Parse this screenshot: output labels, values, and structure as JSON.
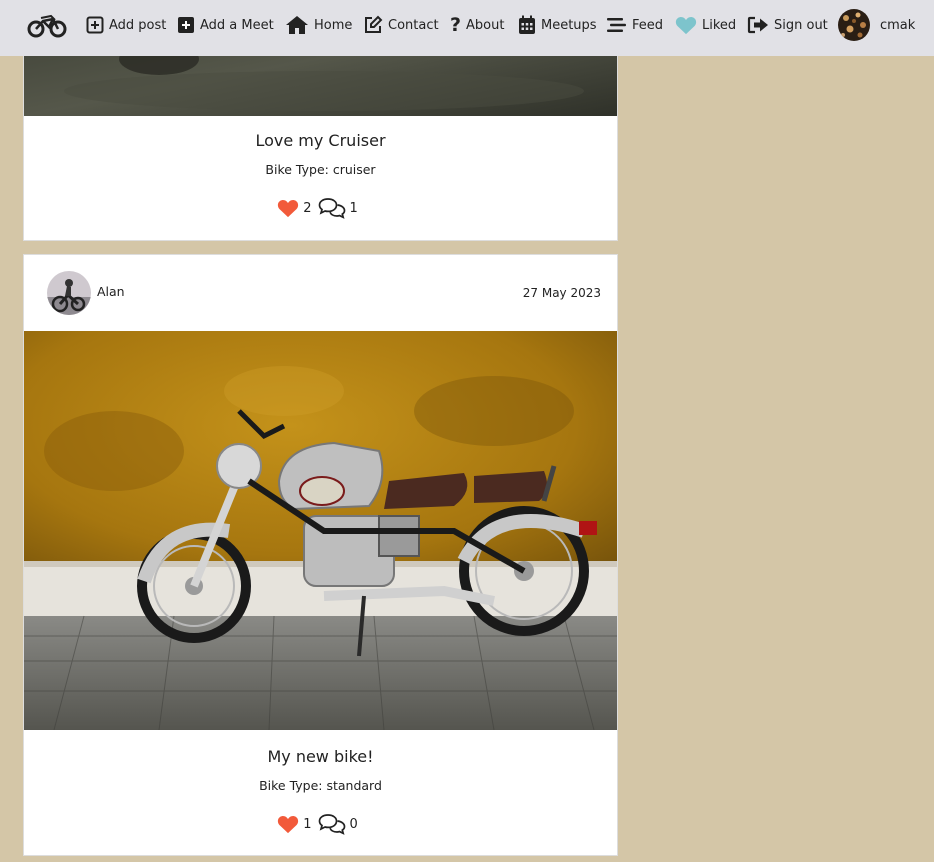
{
  "nav": {
    "add_post": "Add post",
    "add_meet": "Add a Meet",
    "home": "Home",
    "contact": "Contact",
    "about": "About",
    "meetups": "Meetups",
    "feed": "Feed",
    "liked": "Liked",
    "sign_out": "Sign out",
    "username": "cmak"
  },
  "colors": {
    "background": "#d4c6a7",
    "navbar": "#e1e1e6",
    "heart": "#f25a3a",
    "liked_heart": "#7dc4cc"
  },
  "posts": [
    {
      "title": "Love my Cruiser",
      "bike_type": "Bike Type: cruiser",
      "likes": "2",
      "comments": "1"
    },
    {
      "author": "Alan",
      "date": "27 May 2023",
      "title": "My new bike!",
      "bike_type": "Bike Type: standard",
      "likes": "1",
      "comments": "0"
    }
  ]
}
